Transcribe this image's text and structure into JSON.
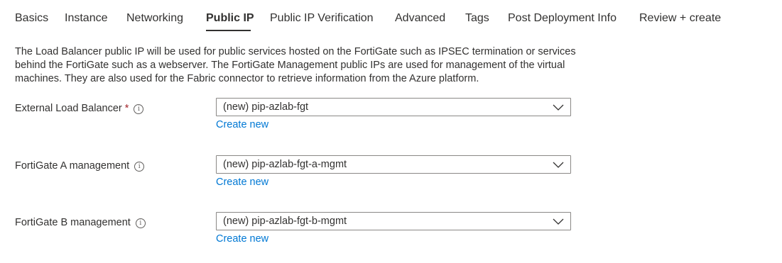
{
  "tabs": [
    {
      "label": "Basics"
    },
    {
      "label": "Instance"
    },
    {
      "label": "Networking"
    },
    {
      "label": "Public IP"
    },
    {
      "label": "Public IP Verification"
    },
    {
      "label": "Advanced"
    },
    {
      "label": "Tags"
    },
    {
      "label": "Post Deployment Info"
    },
    {
      "label": "Review + create"
    }
  ],
  "active_tab": "Public IP",
  "description": "The Load Balancer public IP will be used for public services hosted on the FortiGate such as IPSEC termination or services behind the FortiGate such as a webserver. The FortiGate Management public IPs are used for management of the virtual machines. They are also used for the Fabric connector to retrieve information from the Azure platform.",
  "fields": [
    {
      "label": "External Load Balancer",
      "required_mark": "*",
      "info_icon": "info-icon",
      "value": "(new) pip-azlab-fgt",
      "link": "Create new"
    },
    {
      "label": "FortiGate A management",
      "info_icon": "info-icon",
      "value": "(new) pip-azlab-fgt-a-mgmt",
      "link": "Create new"
    },
    {
      "label": "FortiGate B management",
      "info_icon": "info-icon",
      "value": "(new) pip-azlab-fgt-b-mgmt",
      "link": "Create new"
    }
  ],
  "colors": {
    "text": "#323130",
    "link": "#0078d4",
    "required": "#a4262c",
    "border": "#8a8886"
  }
}
